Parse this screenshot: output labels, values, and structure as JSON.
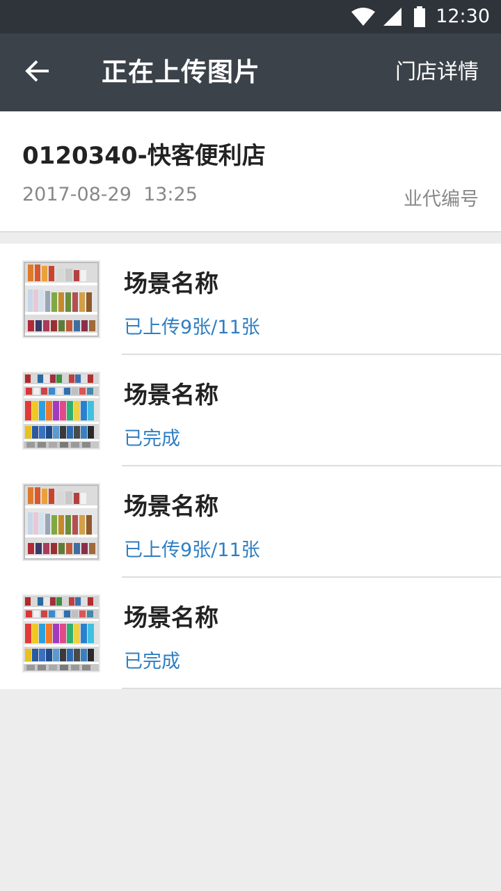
{
  "status_bar": {
    "time": "12:30",
    "icons": [
      "wifi-icon",
      "cellular-signal-icon",
      "battery-icon"
    ]
  },
  "app_bar": {
    "back_icon": "arrow-left-icon",
    "title": "正在上传图片",
    "action_label": "门店详情"
  },
  "store": {
    "name": "0120340-快客便利店",
    "datetime": "2017-08-29  13:25",
    "code_label": "业代编号"
  },
  "scenes": [
    {
      "name": "场景名称",
      "status": "已上传9张/11张",
      "thumbnail": "shelf-photo-a"
    },
    {
      "name": "场景名称",
      "status": "已完成",
      "thumbnail": "shelf-photo-b"
    },
    {
      "name": "场景名称",
      "status": "已上传9张/11张",
      "thumbnail": "shelf-photo-a"
    },
    {
      "name": "场景名称",
      "status": "已完成",
      "thumbnail": "shelf-photo-b"
    }
  ],
  "colors": {
    "status_bar_bg": "#2f343a",
    "app_bar_bg": "#3b4249",
    "status_text": "#2f7ec2",
    "page_bg": "#ededed"
  }
}
